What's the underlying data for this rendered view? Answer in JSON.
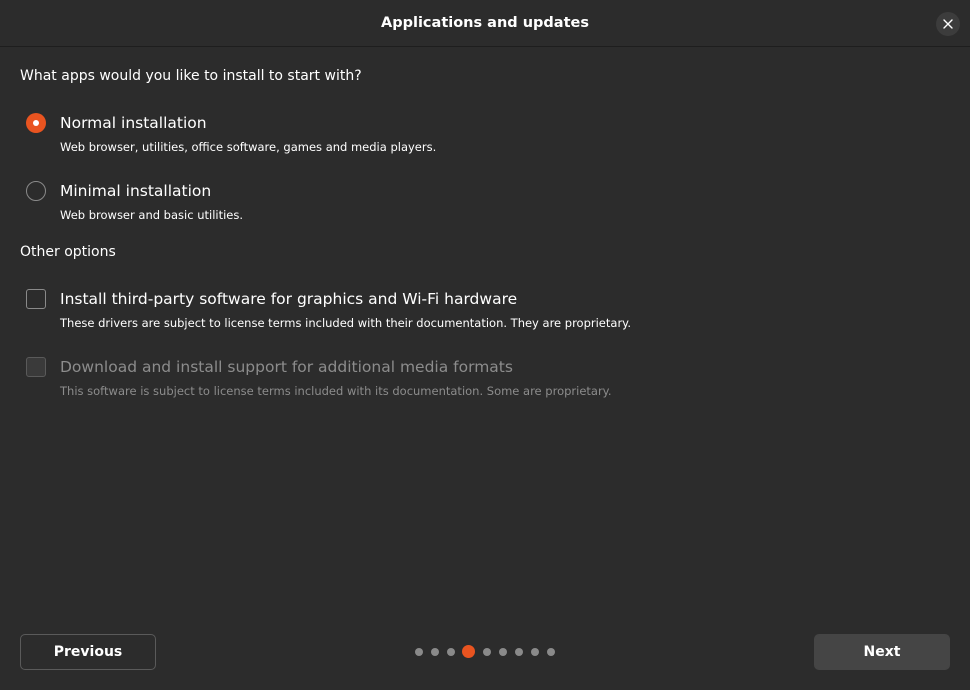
{
  "window": {
    "title": "Applications and updates"
  },
  "question": "What apps would you like to install to start with?",
  "install_options": [
    {
      "label": "Normal installation",
      "description": "Web browser, utilities, office software, games and media players.",
      "selected": true
    },
    {
      "label": "Minimal installation",
      "description": "Web browser and basic utilities.",
      "selected": false
    }
  ],
  "other_options_title": "Other options",
  "other_options": [
    {
      "label": "Install third-party software for graphics and Wi-Fi hardware",
      "description": "These drivers are subject to license terms included with their documentation. They are proprietary.",
      "checked": false,
      "enabled": true
    },
    {
      "label": "Download and install support for additional media formats",
      "description": "This software is subject to license terms included with its documentation. Some are proprietary.",
      "checked": false,
      "enabled": false
    }
  ],
  "footer": {
    "previous_label": "Previous",
    "next_label": "Next"
  },
  "pager": {
    "total_pages": 9,
    "current_page": 4
  },
  "colors": {
    "accent": "#e95420",
    "background": "#2c2c2c"
  },
  "icons": {
    "close": "close-icon"
  }
}
